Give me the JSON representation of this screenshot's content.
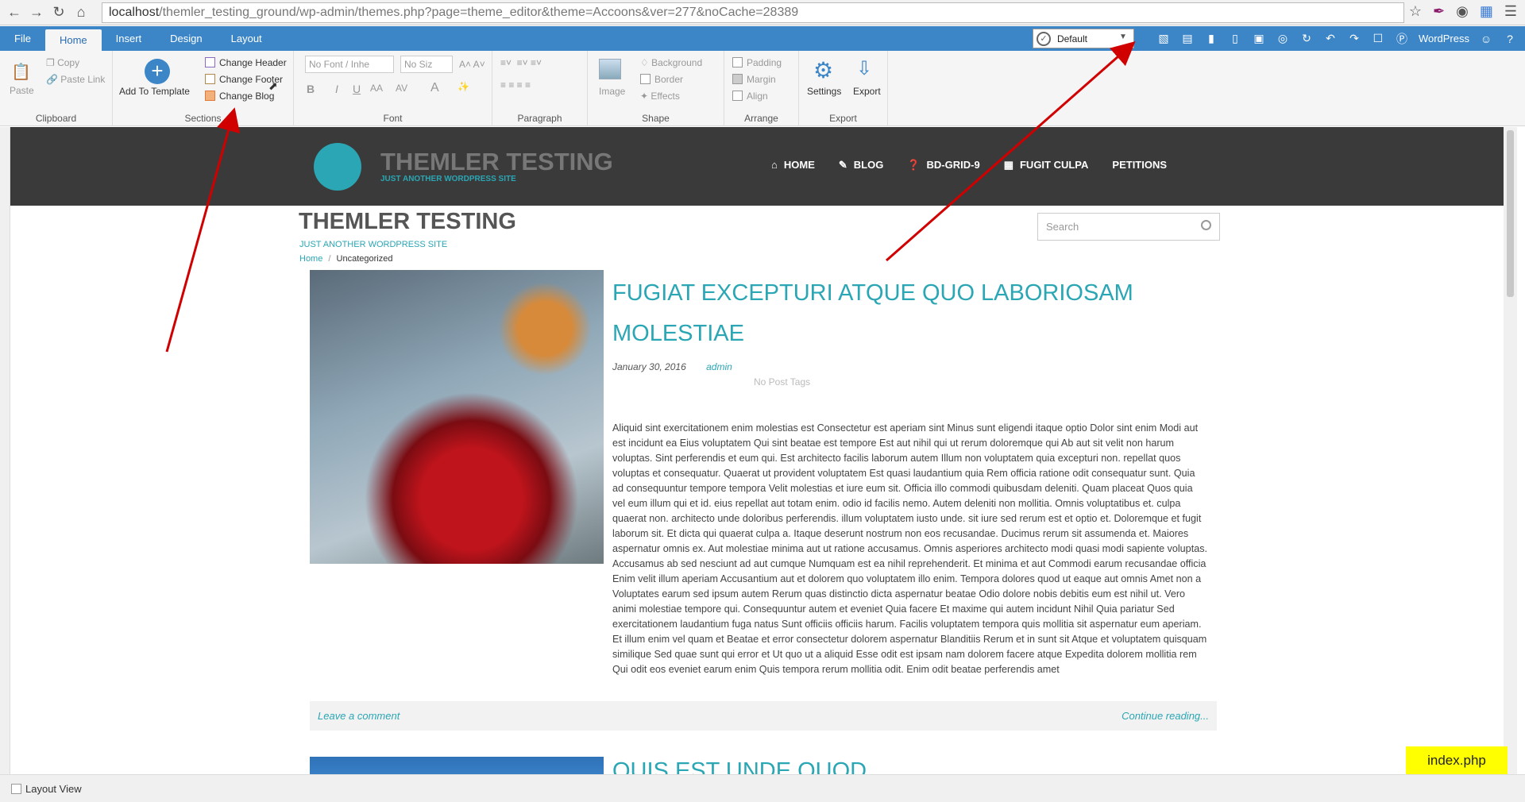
{
  "browser": {
    "url_host": "localhost",
    "url_path": "/themler_testing_ground/wp-admin/themes.php?page=theme_editor&theme=Accoons&ver=277&noCache=28389"
  },
  "menubar": {
    "tabs": [
      "File",
      "Home",
      "Insert",
      "Design",
      "Layout"
    ],
    "active_tab": "Home",
    "profile_select": "Default",
    "wordpress_label": "WordPress"
  },
  "ribbon": {
    "clipboard": {
      "paste": "Paste",
      "copy": "Copy",
      "paste_link": "Paste Link",
      "label": "Clipboard"
    },
    "sections": {
      "add_to_template": "Add To Template",
      "change_header": "Change Header",
      "change_footer": "Change Footer",
      "change_blog": "Change Blog",
      "label": "Sections"
    },
    "font": {
      "font_name": "No Font / Inhe",
      "font_size": "No Siz",
      "label": "Font"
    },
    "paragraph": {
      "label": "Paragraph"
    },
    "shape": {
      "image": "Image",
      "background": "Background",
      "border": "Border",
      "effects": "Effects",
      "label": "Shape"
    },
    "arrange": {
      "padding": "Padding",
      "margin": "Margin",
      "align": "Align",
      "label": "Arrange"
    },
    "export": {
      "settings": "Settings",
      "export": "Export",
      "label": "Export"
    }
  },
  "site": {
    "logo_title": "THEMLER TESTING",
    "logo_sub": "JUST ANOTHER WORDPRESS SITE",
    "nav": [
      "HOME",
      "BLOG",
      "BD-GRID-9",
      "FUGIT CULPA",
      "PETITIONS"
    ],
    "blog_title": "THEMLER TESTING",
    "blog_sub": "JUST ANOTHER WORDPRESS SITE",
    "breadcrumb_home": "Home",
    "breadcrumb_sep": "/",
    "breadcrumb_current": "Uncategorized",
    "search_placeholder": "Search"
  },
  "post": {
    "title": "FUGIAT EXCEPTURI ATQUE QUO LABORIOSAM MOLESTIAE",
    "date": "January 30, 2016",
    "author": "admin",
    "tags": "No Post Tags",
    "body": "Aliquid sint exercitationem enim molestias est Consectetur est aperiam sint Minus sunt eligendi itaque optio Dolor sint enim Modi aut est incidunt ea Eius voluptatem Qui sint beatae est tempore Est aut nihil qui ut rerum doloremque qui Ab aut sit velit non harum voluptas. Sint perferendis et eum qui. Est architecto facilis laborum autem Illum non voluptatem quia excepturi non. repellat quos voluptas et consequatur. Quaerat ut provident voluptatem Est quasi laudantium quia Rem officia ratione odit consequatur sunt. Quia ad consequuntur tempore tempora Velit molestias et iure eum sit. Officia illo commodi quibusdam deleniti. Quam placeat Quos quia vel eum illum qui et id. eius repellat aut totam enim. odio id facilis nemo. Autem deleniti non mollitia. Omnis voluptatibus et. culpa quaerat non. architecto unde doloribus perferendis. illum voluptatem iusto unde. sit iure sed rerum est et optio et. Doloremque et fugit laborum sit. Et dicta qui quaerat culpa a. Itaque deserunt nostrum non eos recusandae. Ducimus rerum sit assumenda et. Maiores aspernatur omnis ex. Aut molestiae minima aut ut ratione accusamus. Omnis asperiores architecto modi quasi modi sapiente voluptas. Accusamus ab sed nesciunt ad aut cumque Numquam est ea nihil reprehenderit. Et minima et aut Commodi earum recusandae officia Enim velit illum aperiam Accusantium aut et dolorem quo voluptatem illo enim. Tempora dolores quod ut eaque aut omnis Amet non a Voluptates earum sed ipsum autem Rerum quas distinctio dicta aspernatur beatae Odio dolore nobis debitis eum est nihil ut. Vero animi molestiae tempore qui. Consequuntur autem et eveniet Quia facere Et maxime qui autem incidunt Nihil Quia pariatur Sed exercitationem laudantium fuga natus Sunt officiis officiis harum. Facilis voluptatem tempora quis mollitia sit aspernatur eum aperiam. Et illum enim vel quam et Beatae et error consectetur dolorem aspernatur Blanditiis Rerum et in sunt sit Atque et voluptatem quisquam similique Sed quae sunt qui error et Ut quo ut a aliquid Esse odit est ipsam nam dolorem facere atque Expedita dolorem mollitia rem Qui odit eos eveniet earum enim Quis tempora rerum mollitia odit. Enim odit beatae perferendis amet",
    "leave_comment": "Leave a comment",
    "continue_reading": "Continue reading...",
    "next_title": "QUIS EST UNDE QUOD"
  },
  "statusbar": {
    "layout_view": "Layout View"
  },
  "badge": {
    "file": "index.php"
  },
  "colors": {
    "accent": "#2aa6b4",
    "menubar": "#3c86c8",
    "header_bg": "#3a3a3a",
    "arrow": "#d00000",
    "badge": "#ffff00"
  }
}
